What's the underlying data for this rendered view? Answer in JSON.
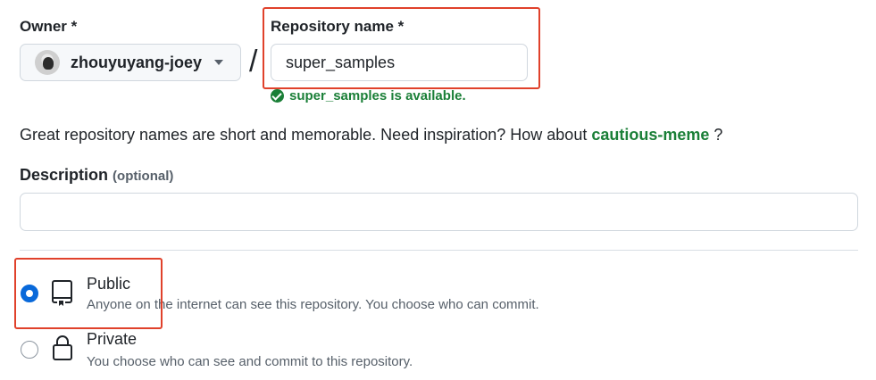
{
  "owner": {
    "label": "Owner *",
    "selected": "zhouyuyang-joey"
  },
  "separator": "/",
  "repo_name": {
    "label": "Repository name *",
    "value": "super_samples",
    "availability": "super_samples is available."
  },
  "hint": {
    "prefix": "Great repository names are short and memorable. Need inspiration? How about ",
    "suggestion": "cautious-meme",
    "suffix": " ?"
  },
  "description": {
    "label": "Description",
    "optional_tag": "(optional)",
    "value": "",
    "placeholder": ""
  },
  "visibility": {
    "options": [
      {
        "title": "Public",
        "description": "Anyone on the internet can see this repository. You choose who can commit.",
        "selected": true,
        "icon": "repo-icon"
      },
      {
        "title": "Private",
        "description": "You choose who can see and commit to this repository.",
        "selected": false,
        "icon": "lock-icon"
      }
    ]
  },
  "colors": {
    "accent_blue": "#0969da",
    "success_green": "#1a7f37",
    "highlight_red": "#e0412b"
  }
}
